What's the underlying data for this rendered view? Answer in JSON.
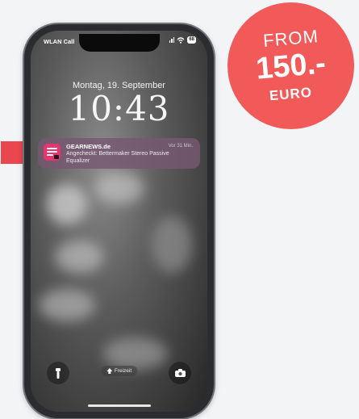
{
  "status_bar": {
    "carrier": "WLAN Call",
    "battery": "68"
  },
  "lock_screen": {
    "date": "Montag, 19. September",
    "time": "10:43"
  },
  "notification": {
    "app": "GEARNEWS.de",
    "timestamp": "Vor 31 Min.",
    "body": "Angecheckt: Bettermaker Stereo Passive Equalizer"
  },
  "bottom_bar": {
    "focus_label": "Freizeit"
  },
  "badge": {
    "from": "FROM",
    "amount": "150.-",
    "currency": "EURO"
  },
  "colors": {
    "badge": "#f25a5a",
    "pointer": "#e8474f",
    "app_icon": "#e8356e"
  },
  "icons": [
    "flashlight-icon",
    "camera-icon",
    "focus-icon",
    "wifi-icon",
    "signal-icon"
  ]
}
